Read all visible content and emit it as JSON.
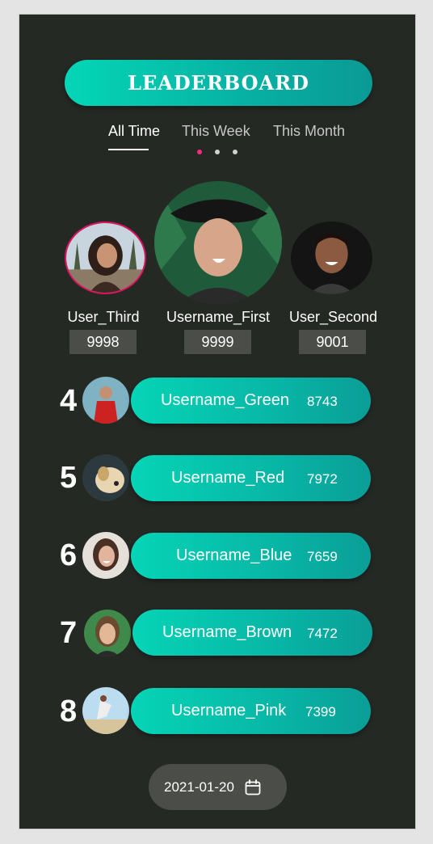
{
  "header": {
    "title": "LEADERBOARD"
  },
  "tabs": [
    {
      "label": "All Time",
      "active": true
    },
    {
      "label": "This Week",
      "active": false
    },
    {
      "label": "This Month",
      "active": false
    }
  ],
  "pager": {
    "count": 3,
    "active_index": 0
  },
  "podium": {
    "first": {
      "name": "Username_First",
      "score": "9999"
    },
    "second": {
      "name": "User_Second",
      "score": "9001"
    },
    "third": {
      "name": "User_Third",
      "score": "9998"
    }
  },
  "ranking": [
    {
      "rank": "4",
      "name": "Username_Green",
      "score": "8743"
    },
    {
      "rank": "5",
      "name": "Username_Red",
      "score": "7972"
    },
    {
      "rank": "6",
      "name": "Username_Blue",
      "score": "7659"
    },
    {
      "rank": "7",
      "name": "Username_Brown",
      "score": "7472"
    },
    {
      "rank": "8",
      "name": "Username_Pink",
      "score": "7399"
    }
  ],
  "footer": {
    "date": "2021-01-20",
    "icon": "calendar-icon"
  },
  "colors": {
    "accent": "#04d6b6",
    "background": "#252924",
    "pager_active": "#ff2a7a",
    "highlight": "#e0115f"
  }
}
